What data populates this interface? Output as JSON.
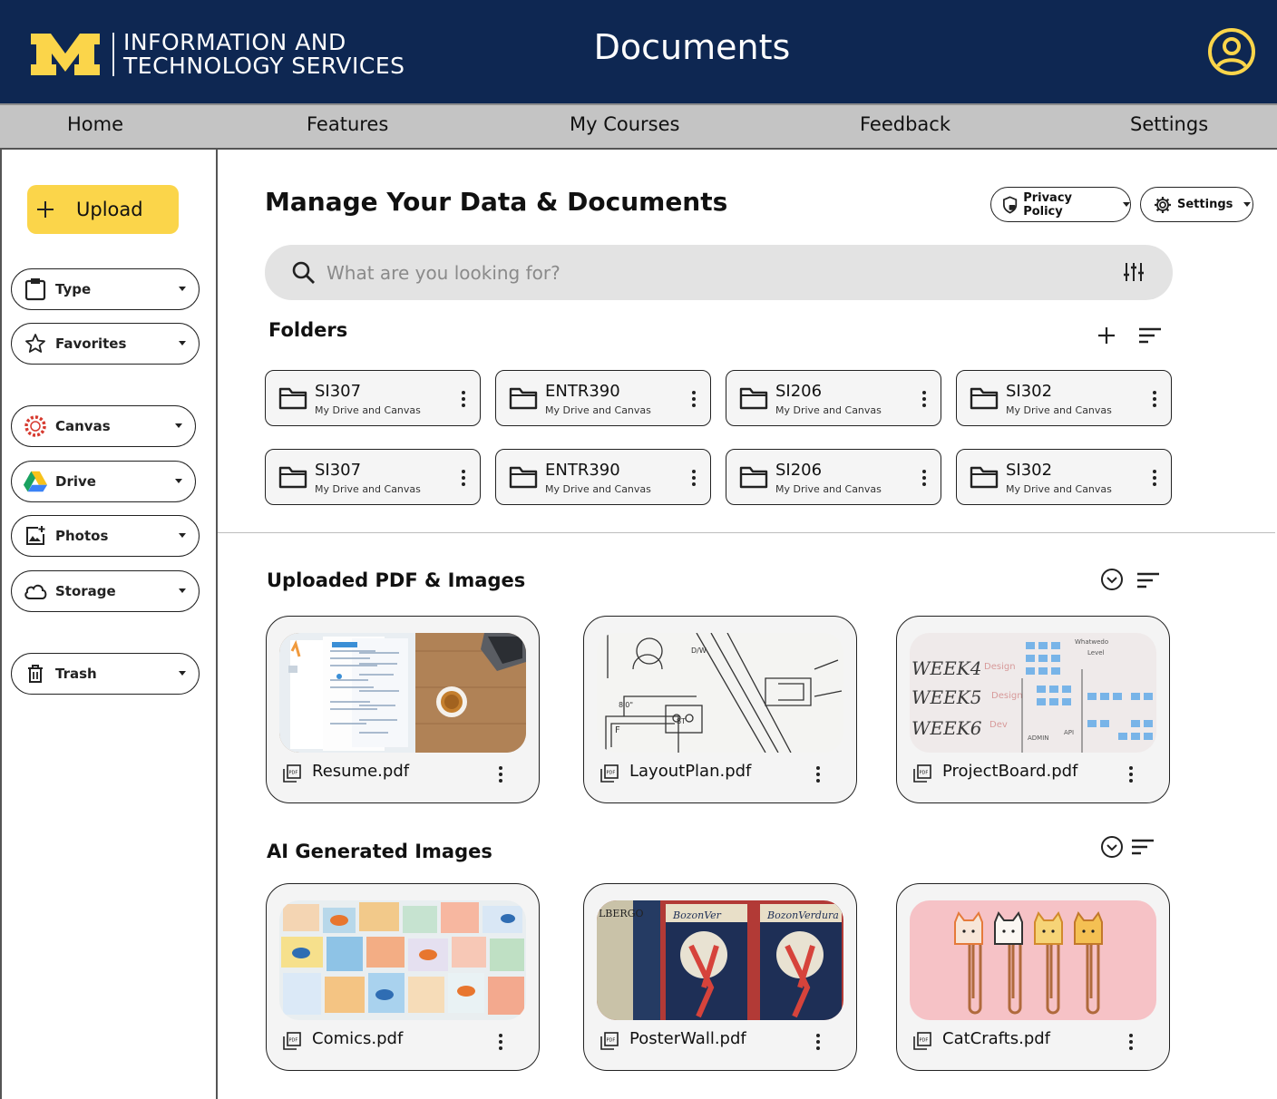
{
  "header": {
    "org_line1": "INFORMATION AND",
    "org_line2": "TECHNOLOGY SERVICES",
    "title": "Documents",
    "brand_color": "#0e2752",
    "accent_color": "#fbd54a"
  },
  "nav": {
    "items": [
      "Home",
      "Features",
      "My Courses",
      "Feedback",
      "Settings"
    ]
  },
  "sidebar": {
    "upload_label": "Upload",
    "filters": [
      {
        "label": "Type",
        "icon": "clipboard-icon"
      },
      {
        "label": "Favorites",
        "icon": "star-icon"
      },
      {
        "label": "Canvas",
        "icon": "canvas-logo-icon"
      },
      {
        "label": "Drive",
        "icon": "google-drive-icon"
      },
      {
        "label": "Photos",
        "icon": "add-photo-icon"
      },
      {
        "label": "Storage",
        "icon": "cloud-icon"
      },
      {
        "label": "Trash",
        "icon": "trash-icon"
      }
    ]
  },
  "main": {
    "title": "Manage Your Data & Documents",
    "privacy_label": "Privacy Policy",
    "settings_label": "Settings",
    "search_placeholder": "What are you looking for?",
    "folders_title": "Folders",
    "folders": [
      {
        "name": "SI307",
        "location": "My Drive and Canvas"
      },
      {
        "name": "ENTR390",
        "location": "My Drive and Canvas"
      },
      {
        "name": "SI206",
        "location": "My Drive and Canvas"
      },
      {
        "name": "SI302",
        "location": "My Drive and Canvas"
      },
      {
        "name": "SI307",
        "location": "My Drive and Canvas"
      },
      {
        "name": "ENTR390",
        "location": "My Drive and Canvas"
      },
      {
        "name": "SI206",
        "location": "My Drive and Canvas"
      },
      {
        "name": "SI302",
        "location": "My Drive and Canvas"
      }
    ],
    "uploaded_title": "Uploaded PDF & Images",
    "uploaded_files": [
      {
        "name": "Resume.pdf"
      },
      {
        "name": "LayoutPlan.pdf"
      },
      {
        "name": "ProjectBoard.pdf"
      }
    ],
    "ai_title": "AI Generated Images",
    "ai_files": [
      {
        "name": "Comics.pdf"
      },
      {
        "name": "PosterWall.pdf"
      },
      {
        "name": "CatCrafts.pdf"
      }
    ]
  }
}
